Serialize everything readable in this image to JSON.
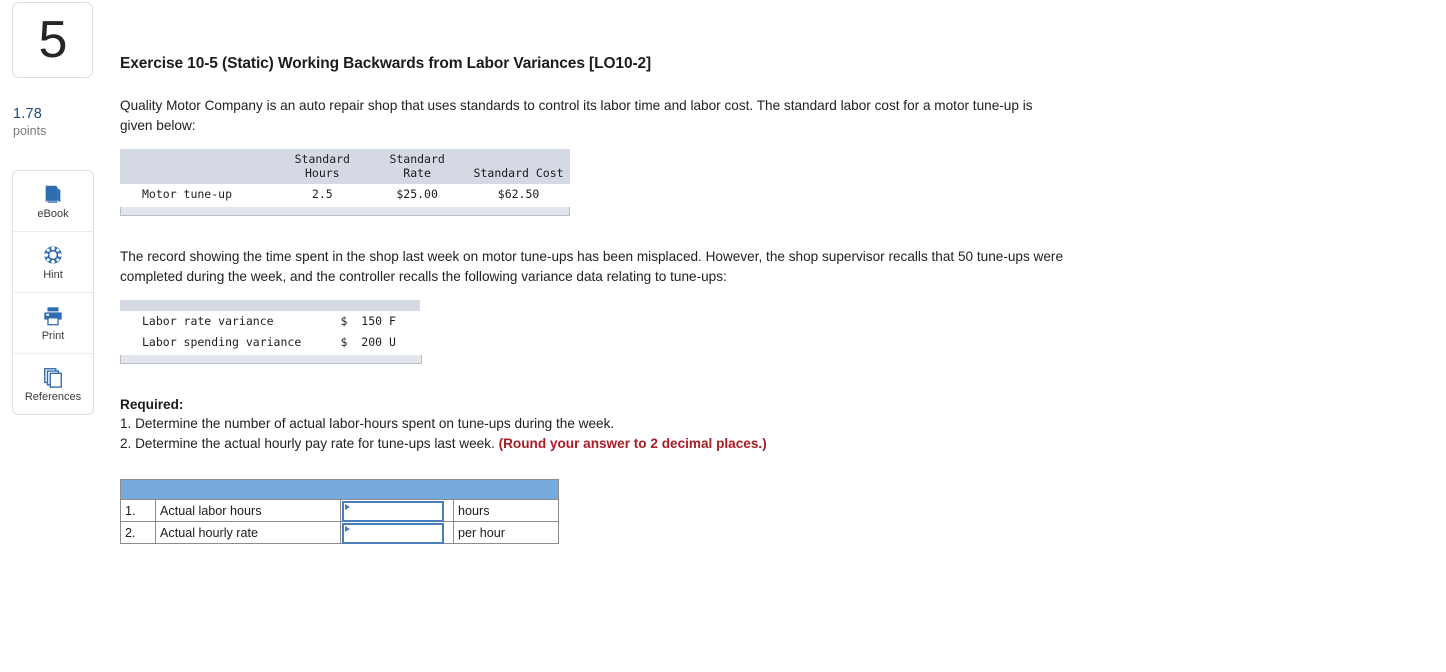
{
  "question": {
    "number": "5",
    "points_value": "1.78",
    "points_label": "points"
  },
  "tools": [
    {
      "label": "eBook",
      "icon": "ebook-icon"
    },
    {
      "label": "Hint",
      "icon": "hint-icon"
    },
    {
      "label": "Print",
      "icon": "print-icon"
    },
    {
      "label": "References",
      "icon": "references-icon"
    }
  ],
  "exercise": {
    "title": "Exercise 10-5 (Static) Working Backwards from Labor Variances [LO10-2]",
    "paragraph1": "Quality Motor Company is an auto repair shop that uses standards to control its labor time and labor cost. The standard labor cost for a motor tune-up is given below:",
    "paragraph2": "The record showing the time spent in the shop last week on motor tune-ups has been misplaced. However, the shop supervisor recalls that 50 tune-ups were completed during the week, and the controller recalls the following variance data relating to tune-ups:"
  },
  "standard_table": {
    "headers": [
      "",
      "Standard\nHours",
      "Standard Rate",
      "Standard Cost"
    ],
    "rows": [
      {
        "label": "Motor tune-up",
        "hours": "2.5",
        "rate": "$25.00",
        "cost": "$62.50"
      }
    ]
  },
  "variance_table": {
    "rows": [
      {
        "label": "Labor rate variance",
        "value": "$  150 F"
      },
      {
        "label": "Labor spending variance",
        "value": "$  200 U"
      }
    ]
  },
  "required": {
    "heading": "Required:",
    "item1": "1. Determine the number of actual labor-hours spent on tune-ups during the week.",
    "item2_text": "2. Determine the actual hourly pay rate for tune-ups last week.",
    "item2_note": "(Round your answer to 2 decimal places.)"
  },
  "answer_table": {
    "rows": [
      {
        "index": "1.",
        "description": "Actual labor hours",
        "value": "",
        "unit": "hours"
      },
      {
        "index": "2.",
        "description": "Actual hourly rate",
        "value": "",
        "unit": "per hour"
      }
    ]
  },
  "colors": {
    "header_blue": "#76aadd",
    "table_header_gray": "#d4d9e3",
    "input_border": "#4a7ebb",
    "note_red": "#a91d24",
    "points_blue": "#1b4a7a",
    "icon_blue": "#2f6cb0"
  }
}
